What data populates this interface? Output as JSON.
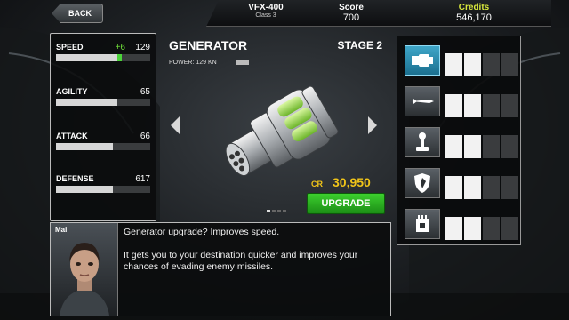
{
  "topbar": {
    "back_label": "BACK",
    "ship_name": "VFX-400",
    "ship_class": "Class 3",
    "score_label": "Score",
    "score_value": "700",
    "credits_label": "Credits",
    "credits_value": "546,170"
  },
  "stats": [
    {
      "name": "SPEED",
      "bonus": "+6",
      "value": "129",
      "fill": 0.65,
      "bonus_fill": 0.05
    },
    {
      "name": "AGILITY",
      "value": "65",
      "fill": 0.65
    },
    {
      "name": "ATTACK",
      "value": "66",
      "fill": 0.6
    },
    {
      "name": "DEFENSE",
      "value": "617",
      "fill": 0.6
    }
  ],
  "upgrade": {
    "title": "GENERATOR",
    "stage": "STAGE 2",
    "power_label": "POWER: 129 KN",
    "price_label": "CR",
    "price": "30,950",
    "button_label": "UPGRADE"
  },
  "slots": [
    {
      "icon": "generator-icon",
      "filled": 2
    },
    {
      "icon": "missile-icon",
      "filled": 2
    },
    {
      "icon": "joystick-icon",
      "filled": 2
    },
    {
      "icon": "shield-icon",
      "filled": 2
    },
    {
      "icon": "chip-icon",
      "filled": 2
    }
  ],
  "dialog": {
    "speaker": "Mai",
    "line1": "Generator upgrade? Improves speed.",
    "line2": "It gets you to your destination quicker and improves your chances of evading enemy missiles."
  },
  "colors": {
    "accent_green": "#3ccf2e",
    "price_gold": "#f0c419",
    "credits_yellow": "#d8e83c",
    "selected_slot": "#3fa6c8"
  }
}
